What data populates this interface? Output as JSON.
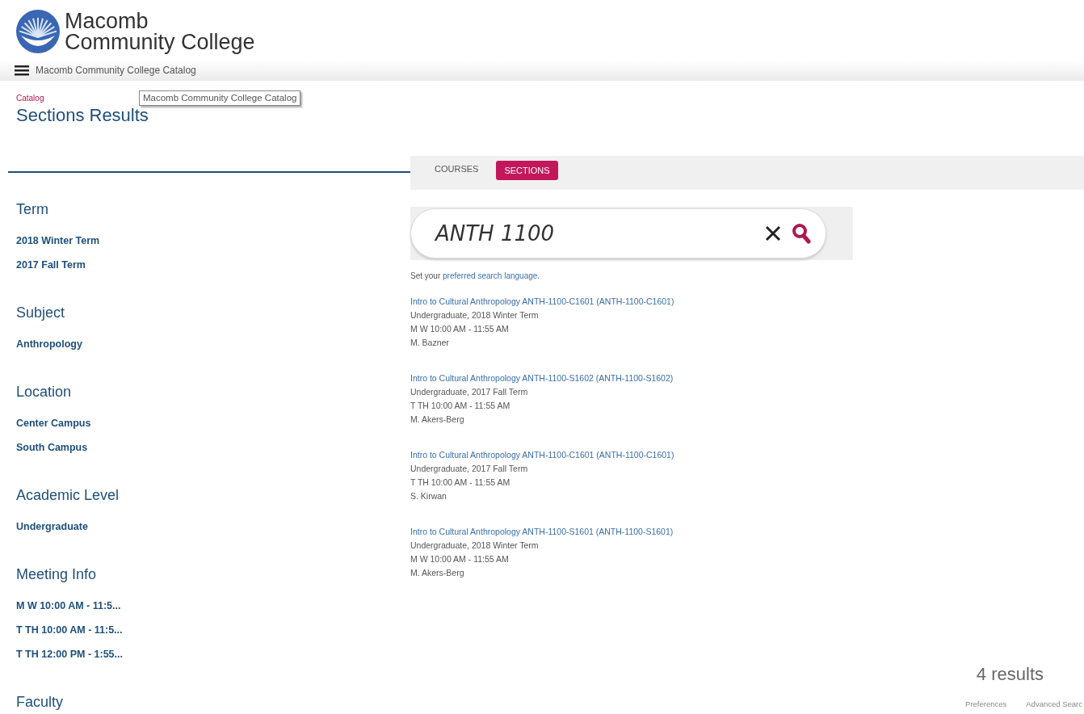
{
  "header": {
    "logo_line_1": "Macomb",
    "logo_line_2": "Community College"
  },
  "nav": {
    "title": "Macomb Community College Catalog",
    "tooltip": "Macomb Community College Catalog"
  },
  "breadcrumb": "Catalog",
  "page_title": "Sections Results",
  "tabs": [
    {
      "label": "COURSES",
      "selected": false
    },
    {
      "label": "SECTIONS",
      "selected": true
    }
  ],
  "search": {
    "value": "ANTH 1100"
  },
  "language_note": {
    "prefix": "Set your ",
    "link": "preferred search language",
    "suffix": "."
  },
  "facets": [
    {
      "heading": "Term",
      "items": [
        "2018 Winter Term",
        "2017 Fall Term"
      ]
    },
    {
      "heading": "Subject",
      "items": [
        "Anthropology"
      ]
    },
    {
      "heading": "Location",
      "items": [
        "Center Campus",
        "South Campus"
      ]
    },
    {
      "heading": "Academic Level",
      "items": [
        "Undergraduate"
      ]
    },
    {
      "heading": "Meeting Info",
      "items": [
        "M W 10:00 AM - 11:5...",
        "T TH 10:00 AM - 11:5...",
        "T TH 12:00 PM - 1:55..."
      ]
    },
    {
      "heading": "Faculty"
    }
  ],
  "results": [
    {
      "title": "Intro to Cultural Anthropology ANTH-1100-C1601 (ANTH-1100-C1601)",
      "term": "Undergraduate, 2018 Winter Term",
      "meeting": "M W 10:00 AM - 11:55 AM",
      "faculty": "M. Bazner"
    },
    {
      "title": "Intro to Cultural Anthropology ANTH-1100-S1602 (ANTH-1100-S1602)",
      "term": "Undergraduate, 2017 Fall Term",
      "meeting": "T TH 10:00 AM - 11:55 AM",
      "faculty": "M. Akers-Berg"
    },
    {
      "title": "Intro to Cultural Anthropology ANTH-1100-C1601 (ANTH-1100-C1601)",
      "term": "Undergraduate, 2017 Fall Term",
      "meeting": "T TH 10:00 AM - 11:55 AM",
      "faculty": "S. Kirwan"
    },
    {
      "title": "Intro to Cultural Anthropology ANTH-1100-S1601 (ANTH-1100-S1601)",
      "term": "Undergraduate, 2018 Winter Term",
      "meeting": "M W 10:00 AM - 11:55 AM",
      "faculty": "M. Akers-Berg"
    }
  ],
  "result_count": "4 results",
  "footer_links": [
    "Preferences",
    "Advanced Searc"
  ]
}
